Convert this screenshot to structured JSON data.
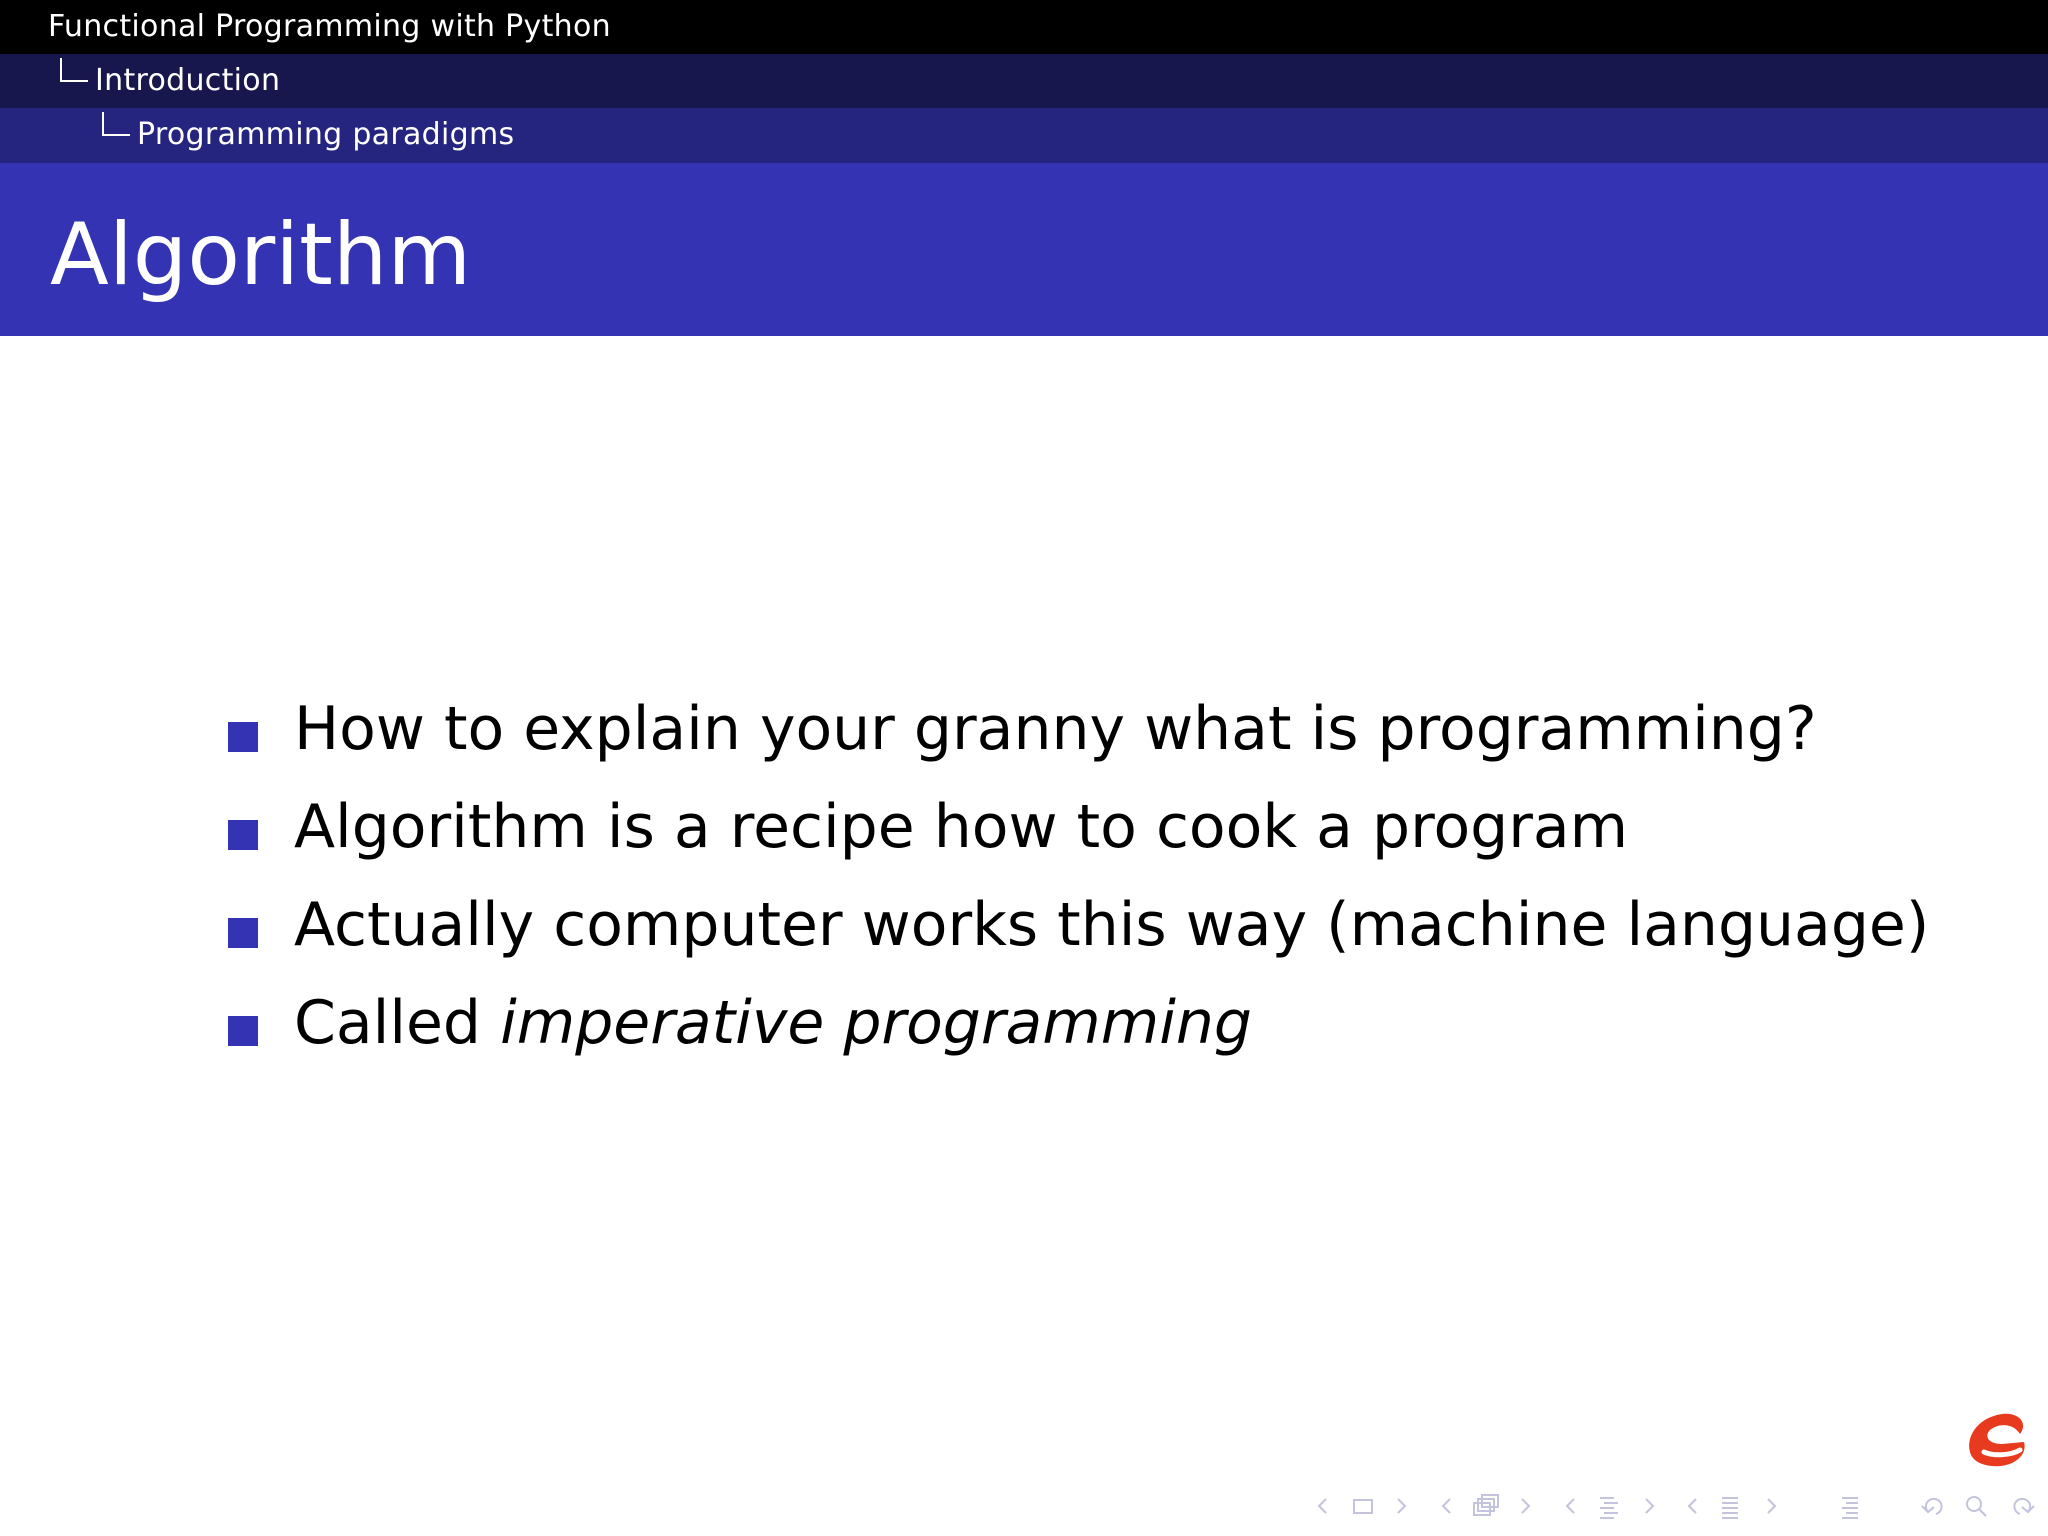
{
  "header": {
    "presentation_title": "Functional Programming with Python",
    "section": "Introduction",
    "subsection": "Programming paradigms"
  },
  "frame": {
    "title": "Algorithm"
  },
  "bullets": [
    {
      "text": "How to explain your granny what is programming?"
    },
    {
      "text": "Algorithm is a recipe how to cook a program"
    },
    {
      "text": "Actually computer works this way (machine language)"
    },
    {
      "prefix": "Called ",
      "emphasis": "imperative programming"
    }
  ],
  "colors": {
    "structure": "#3333b3",
    "header_top": "#000000",
    "header_mid": "#17174d",
    "header_low": "#252580"
  },
  "icons": {
    "logo": "red-swirl-logo-icon",
    "navigation": [
      "arrow-left-icon",
      "frame-icon",
      "arrow-right-icon",
      "arrow-left-icon",
      "subsection-icon",
      "arrow-right-icon",
      "arrow-left-icon",
      "section-icon",
      "arrow-right-icon",
      "arrow-left-icon",
      "document-icon",
      "arrow-right-icon",
      "align-icon",
      "back-icon",
      "search-icon",
      "forward-icon"
    ]
  }
}
